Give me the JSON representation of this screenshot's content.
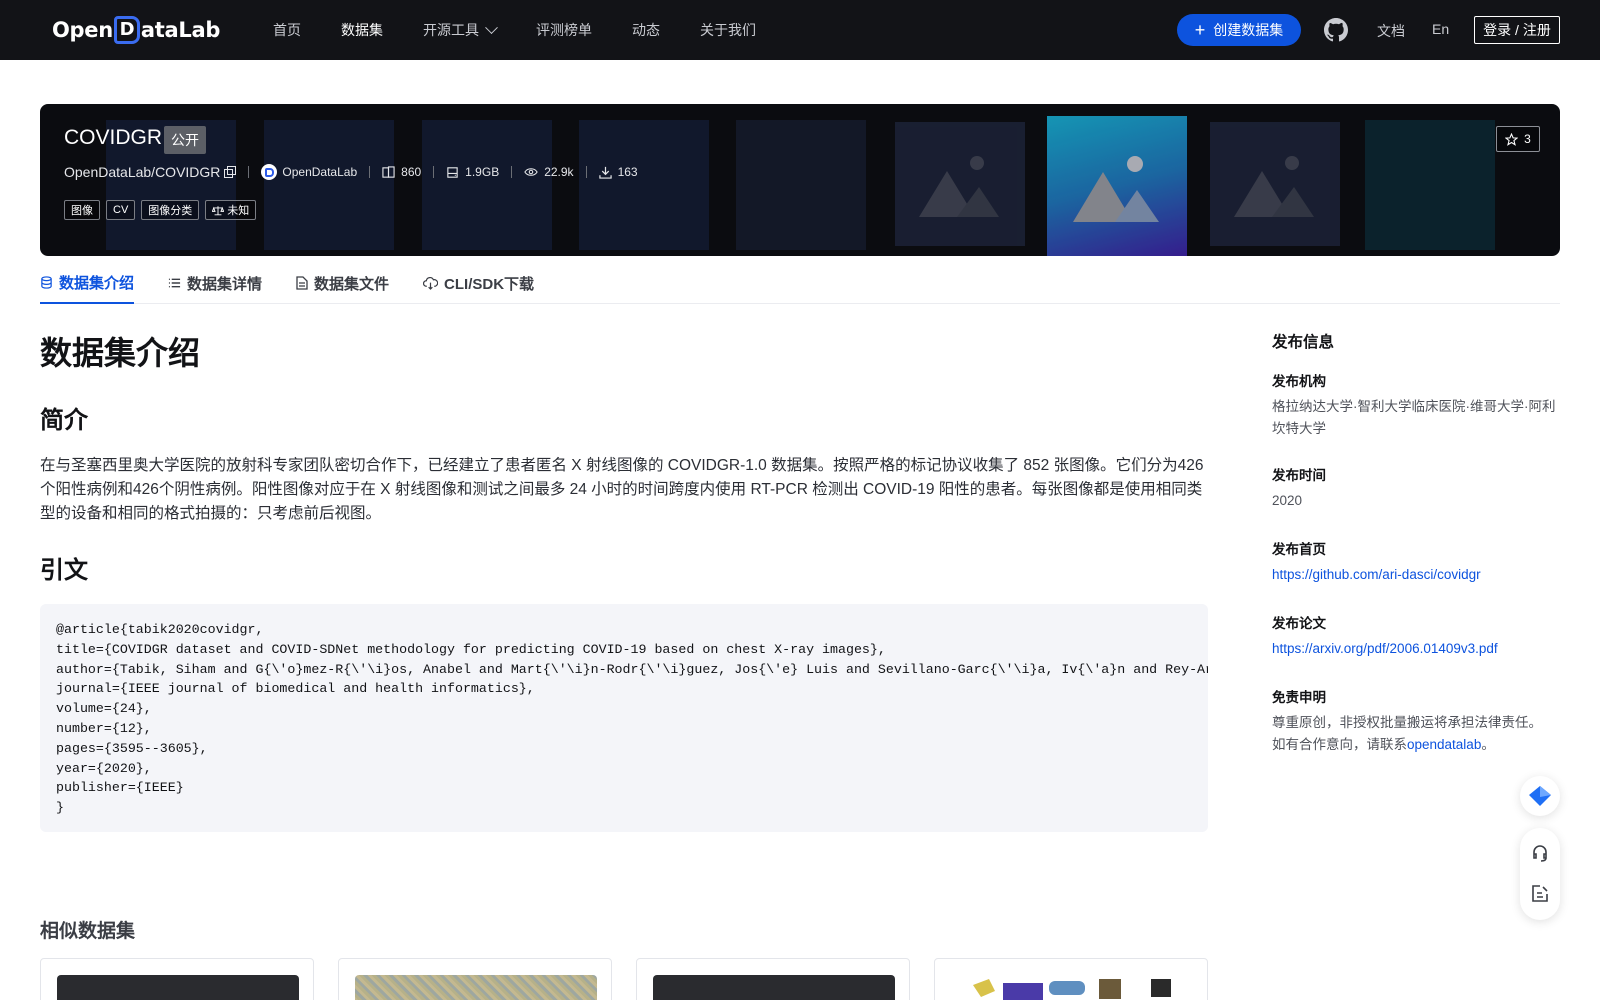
{
  "nav": {
    "logo_text_1": "Open",
    "logo_text_d": "D",
    "logo_text_2": "ataLab",
    "links": [
      {
        "label": "首页"
      },
      {
        "label": "数据集"
      },
      {
        "label": "开源工具"
      },
      {
        "label": "评测榜单"
      },
      {
        "label": "动态"
      },
      {
        "label": "关于我们"
      }
    ],
    "active_link": "数据集",
    "create_button": "创建数据集",
    "docs": "文档",
    "lang": "En",
    "login": "登录 / 注册"
  },
  "dataset": {
    "title": "COVIDGR",
    "visibility": "公开",
    "star_count": "3",
    "repo": "OpenDataLab/COVIDGR",
    "org": "OpenDataLab",
    "file_count": "860",
    "size": "1.9GB",
    "views": "22.9k",
    "downloads": "163",
    "tags": [
      "图像",
      "CV",
      "图像分类"
    ],
    "license": "未知"
  },
  "tabs": [
    {
      "label": "数据集介绍",
      "icon": "database-icon"
    },
    {
      "label": "数据集详情",
      "icon": "list-icon"
    },
    {
      "label": "数据集文件",
      "icon": "file-icon"
    },
    {
      "label": "CLI/SDK下载",
      "icon": "cloud-download-icon"
    }
  ],
  "main": {
    "heading": "数据集介绍",
    "intro_heading": "简介",
    "intro_text": "在与圣塞西里奥大学医院的放射科专家团队密切合作下，已经建立了患者匿名 X 射线图像的 COVIDGR-1.0 数据集。按照严格的标记协议收集了 852 张图像。它们分为426个阳性病例和426个阴性病例。阳性图像对应于在 X 射线图像和测试之间最多 24 小时的时间跨度内使用 RT-PCR 检测出 COVID-19 阳性的患者。每张图像都是使用相同类型的设备和相同的格式拍摄的：只考虑前后视图。",
    "citation_heading": "引文",
    "citation": "@article{tabik2020covidgr,\ntitle={COVIDGR dataset and COVID-SDNet methodology for predicting COVID-19 based on chest X-ray images},\nauthor={Tabik, Siham and G{\\'o}mez-R{\\'\\i}os, Anabel and Mart{\\'\\i}n-Rodr{\\'\\i}guez, Jos{\\'e} Luis and Sevillano-Garc{\\'\\i}a, Iv{\\'a}n and Rey-Area, Manuel and Charte, David and Guirado, Emilio and Su{\\'a}rez, Juan Luis and Luengo, Juli{\\'a}n and Valero-Gonz{\\'a}lez, MA and others},\njournal={IEEE journal of biomedical and health informatics},\nvolume={24},\nnumber={12},\npages={3595--3605},\nyear={2020},\npublisher={IEEE}\n}",
    "similar_heading": "相似数据集"
  },
  "sidebar": {
    "title": "发布信息",
    "org_label": "发布机构",
    "org_value": "格拉纳达大学·智利大学临床医院·维哥大学·阿利坎特大学",
    "time_label": "发布时间",
    "time_value": "2020",
    "home_label": "发布首页",
    "home_url": "https://github.com/ari-dasci/covidgr",
    "paper_label": "发布论文",
    "paper_url": "https://arxiv.org/pdf/2006.01409v3.pdf",
    "disclaimer_label": "免责申明",
    "disclaimer_line1": "尊重原创，非授权批量搬运将承担法律责任。",
    "disclaimer_line2_prefix": "如有合作意向，请联系",
    "disclaimer_link": "opendatalab",
    "disclaimer_suffix": "。"
  },
  "colors": {
    "nav_bg": "#121317",
    "accent": "#0d53de",
    "banner_bg": "#0b0c10"
  }
}
